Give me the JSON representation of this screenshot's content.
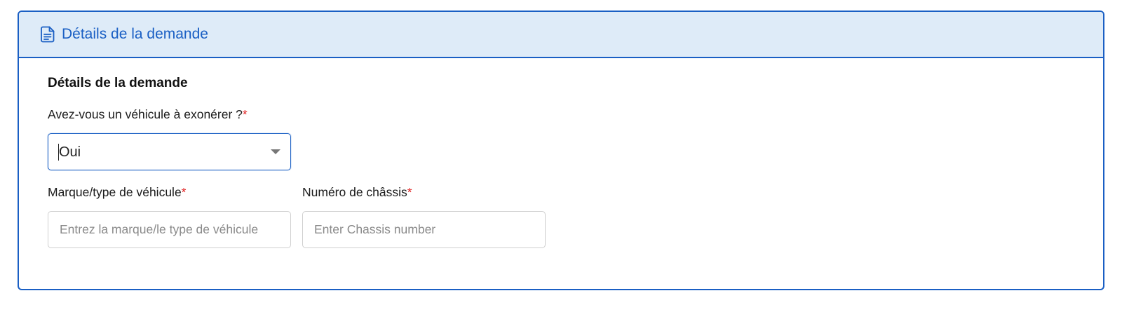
{
  "panel": {
    "header_title": "Détails de la demande",
    "header_icon": "document-icon",
    "accent_color": "#1a5fc4",
    "header_bg": "#deebf8"
  },
  "form": {
    "section_title": "Détails de la demande",
    "vehicle_question": {
      "label": "Avez-vous un véhicule à exonérer ?",
      "required_mark": "*",
      "selected_value": "Oui"
    },
    "vehicle_make": {
      "label": "Marque/type de véhicule",
      "required_mark": "*",
      "value": "",
      "placeholder": "Entrez la marque/le type de véhicule"
    },
    "chassis_number": {
      "label": "Numéro de châssis",
      "required_mark": "*",
      "value": "",
      "placeholder": "Enter Chassis number"
    }
  }
}
